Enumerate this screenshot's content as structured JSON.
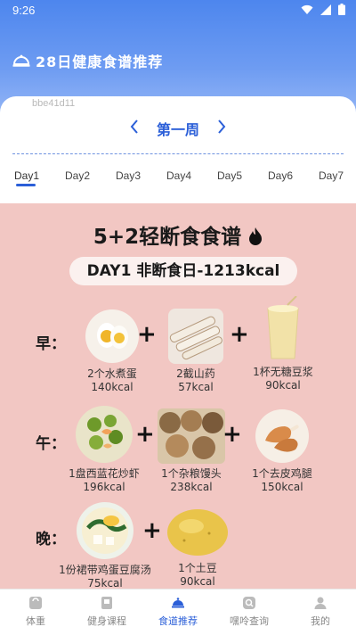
{
  "status": {
    "time": "9:26"
  },
  "header": {
    "title": "28日健康食谱推荐",
    "icon": "food-cloche-icon"
  },
  "watermark": "bbe41d11",
  "week": {
    "label": "第一周"
  },
  "days": {
    "items": [
      "Day1",
      "Day2",
      "Day3",
      "Day4",
      "Day5",
      "Day6",
      "Day7"
    ],
    "active": "Day1"
  },
  "poster": {
    "title": "5+2轻断食食谱",
    "day_title": "DAY1  非断食日-1213kcal",
    "meals": [
      {
        "label": "早：",
        "items": [
          {
            "name": "2个水煮蛋",
            "kcal": "140kcal"
          },
          {
            "name": "2截山药",
            "kcal": "57kcal"
          },
          {
            "name": "1杯无糖豆浆",
            "kcal": "90kcal"
          }
        ]
      },
      {
        "label": "午：",
        "items": [
          {
            "name": "1盘西蓝花炒虾",
            "kcal": "196kcal"
          },
          {
            "name": "1个杂粮馒头",
            "kcal": "238kcal"
          },
          {
            "name": "1个去皮鸡腿",
            "kcal": "150kcal"
          }
        ]
      },
      {
        "label": "晚：",
        "items": [
          {
            "name": "1份裙带鸡蛋豆腐汤",
            "kcal": "75kcal"
          },
          {
            "name": "1个土豆",
            "kcal": "90kcal"
          }
        ]
      }
    ]
  },
  "tabbar": {
    "items": [
      {
        "label": "体重",
        "icon": "scale-icon"
      },
      {
        "label": "健身课程",
        "icon": "video-course-icon"
      },
      {
        "label": "食道推荐",
        "icon": "food-cloche-icon"
      },
      {
        "label": "嘿呤查询",
        "icon": "search-icon"
      },
      {
        "label": "我的",
        "icon": "user-icon"
      }
    ],
    "active": "食道推荐"
  },
  "colors": {
    "accent": "#2b5fd8",
    "header_gradient_top": "#4d86ee",
    "poster_bg": "#f2c7c3"
  }
}
